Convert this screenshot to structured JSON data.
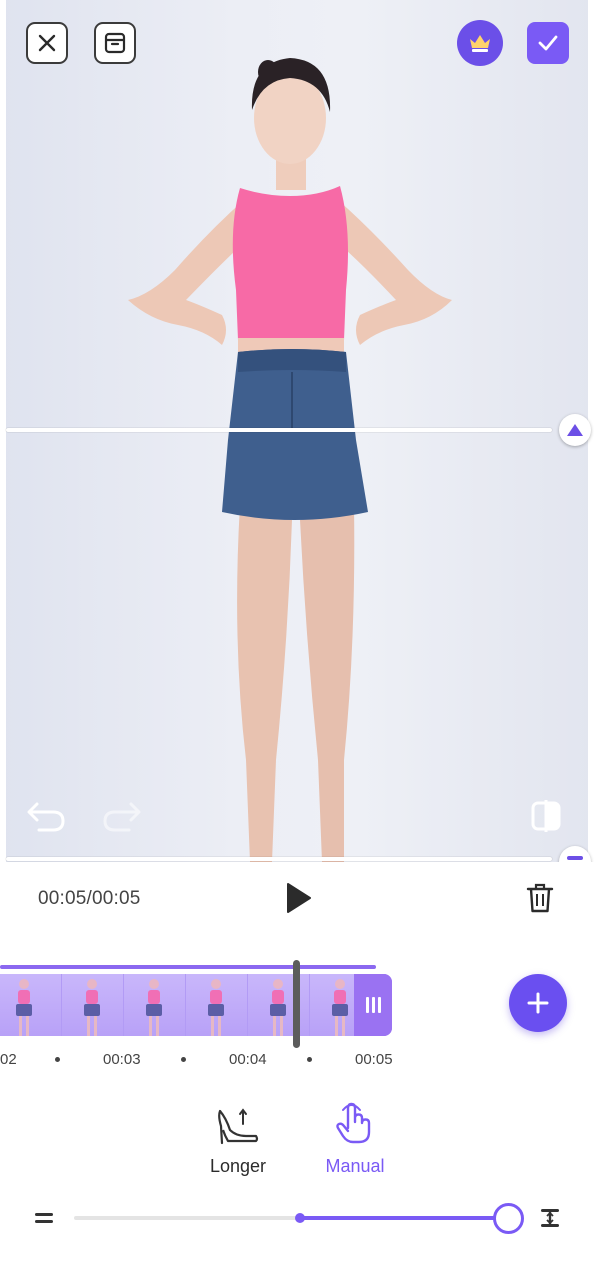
{
  "toolbar": {
    "close_icon": "close-icon",
    "archive_icon": "archive-icon",
    "premium_icon": "crown-icon",
    "confirm_icon": "check-icon",
    "accent_color": "#7a5af5"
  },
  "preview": {
    "undo_icon": "undo-icon",
    "redo_icon": "redo-icon",
    "compare_icon": "compare-icon"
  },
  "playback": {
    "time": "00:05/00:05",
    "play_icon": "play-icon",
    "delete_icon": "trash-icon"
  },
  "timeline": {
    "ticks": [
      "02",
      "00:03",
      "00:04",
      "00:05"
    ],
    "add_icon": "plus-icon"
  },
  "modes": [
    {
      "label": "Longer",
      "icon": "high-heel-icon",
      "selected": false
    },
    {
      "label": "Manual",
      "icon": "hand-pointer-icon",
      "selected": true
    }
  ],
  "slider": {
    "min_icon": "compress-icon",
    "max_icon": "stretch-icon",
    "range_start": 0.52,
    "value": 1.0
  }
}
